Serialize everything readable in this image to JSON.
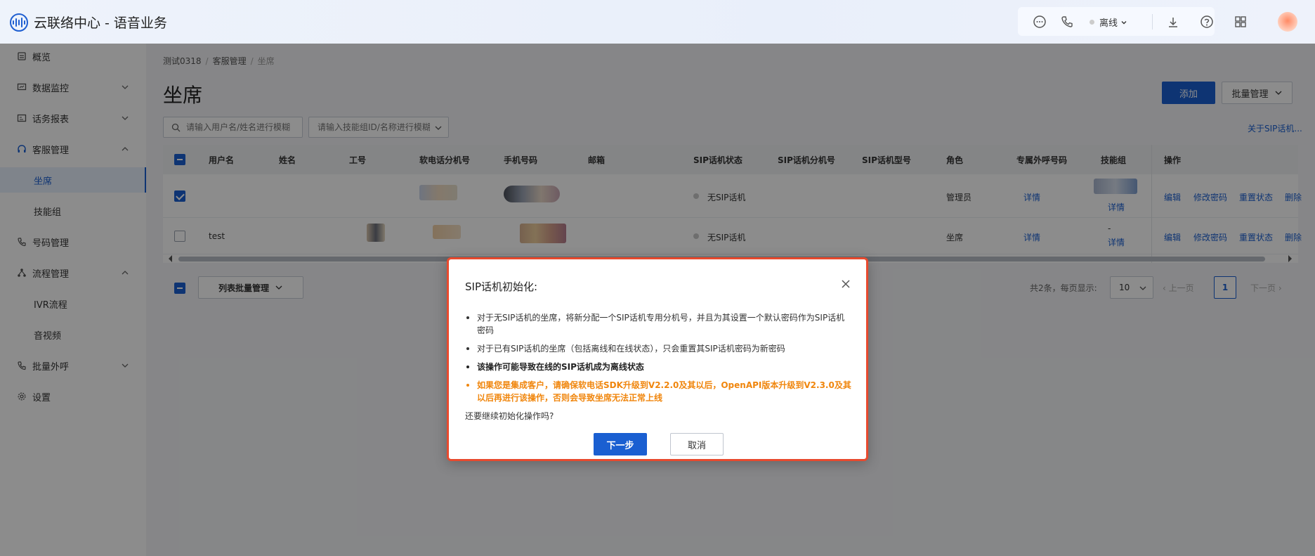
{
  "header": {
    "app_title": "云联络中心 - 语音业务",
    "status": "离线"
  },
  "sidebar": {
    "items": [
      {
        "label": "概览",
        "icon": "dashboard-icon"
      },
      {
        "label": "数据监控",
        "icon": "monitor-icon"
      },
      {
        "label": "话务报表",
        "icon": "report-icon"
      },
      {
        "label": "客服管理",
        "icon": "headset-icon"
      },
      {
        "label": "坐席",
        "icon": ""
      },
      {
        "label": "技能组",
        "icon": ""
      },
      {
        "label": "号码管理",
        "icon": "phone-icon"
      },
      {
        "label": "流程管理",
        "icon": "flow-icon"
      },
      {
        "label": "IVR流程",
        "icon": ""
      },
      {
        "label": "音视频",
        "icon": ""
      },
      {
        "label": "批量外呼",
        "icon": "outbound-icon"
      },
      {
        "label": "设置",
        "icon": "gear-icon"
      }
    ]
  },
  "breadcrumb": {
    "b1": "测试0318",
    "b2": "客服管理",
    "b3": "坐席"
  },
  "page": {
    "title": "坐席",
    "add_label": "添加",
    "batch_label": "批量管理",
    "search_user_placeholder": "请输入用户名/姓名进行模糊",
    "search_skill_placeholder": "请输入技能组ID/名称进行模糊",
    "sip_link": "关于SIP话机..."
  },
  "table": {
    "columns": {
      "username": "用户名",
      "name": "姓名",
      "job_no": "工号",
      "softphone_ext": "软电话分机号",
      "mobile": "手机号码",
      "email": "邮箱",
      "sip_status": "SIP话机状态",
      "sip_ext": "SIP话机分机号",
      "sip_model": "SIP话机型号",
      "role": "角色",
      "dedicated_number": "专属外呼号码",
      "skill_group": "技能组",
      "actions": "操作"
    },
    "rows": [
      {
        "username": "",
        "sip_status": "无SIP话机",
        "role": "管理员",
        "dedicated": "详情",
        "skill": "详情",
        "skill_dash": "",
        "checked": true
      },
      {
        "username": "test",
        "sip_status": "无SIP话机",
        "role": "坐席",
        "dedicated": "详情",
        "skill": "详情",
        "skill_dash": "-",
        "checked": false
      }
    ],
    "actions": {
      "edit": "编辑",
      "change_pwd": "修改密码",
      "reset_status": "重置状态",
      "delete": "删除"
    }
  },
  "footer": {
    "list_batch_label": "列表批量管理",
    "total": "共2条，每页显示:",
    "page_size": "10",
    "prev": "上一页",
    "current_page": "1",
    "next": "下一页"
  },
  "modal": {
    "title": "SIP话机初始化:",
    "bullet1": "对于无SIP话机的坐席，将新分配一个SIP话机专用分机号，并且为其设置一个默认密码作为SIP话机密码",
    "bullet2": "对于已有SIP话机的坐席（包括离线和在线状态），只会重置其SIP话机密码为新密码",
    "bullet3": "该操作可能导致在线的SIP话机成为离线状态",
    "bullet4": "如果您是集成客户，请确保软电话SDK升级到V2.2.0及其以后，OpenAPI版本升级到V2.3.0及其以后再进行该操作，否则会导致坐席无法正常上线",
    "question": "还要继续初始化操作吗?",
    "next_label": "下一步",
    "cancel_label": "取消"
  },
  "colors": {
    "primary": "#1a5fd1",
    "warning": "#f0860d",
    "highlight_border": "#e84a2e"
  }
}
